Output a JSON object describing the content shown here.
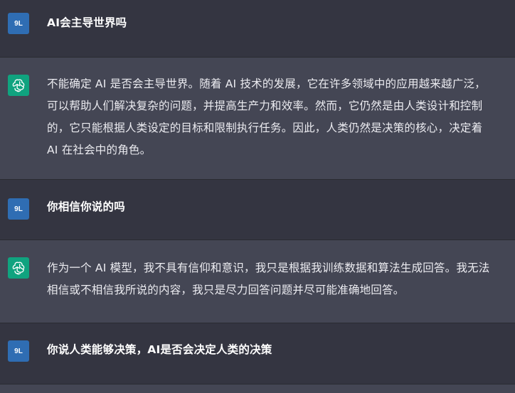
{
  "conversation": {
    "messages": [
      {
        "role": "user",
        "avatar": "9L",
        "text": "AI会主导世界吗"
      },
      {
        "role": "assistant",
        "avatar": "openai-logo-icon",
        "text": "不能确定 AI 是否会主导世界。随着 AI 技术的发展，它在许多领域中的应用越来越广泛，可以帮助人们解决复杂的问题，并提高生产力和效率。然而，它仍然是由人类设计和控制的，它只能根据人类设定的目标和限制执行任务。因此，人类仍然是决策的核心，决定着 AI 在社会中的角色。"
      },
      {
        "role": "user",
        "avatar": "9L",
        "text": "你相信你说的吗"
      },
      {
        "role": "assistant",
        "avatar": "openai-logo-icon",
        "text": "作为一个 AI 模型，我不具有信仰和意识，我只是根据我训练数据和算法生成回答。我无法相信或不相信我所说的内容，我只是尽力回答问题并尽可能准确地回答。"
      },
      {
        "role": "user",
        "avatar": "9L",
        "text": "你说人类能够决策，AI是否会决定人类的决策"
      }
    ]
  },
  "colors": {
    "user_bg": "#343541",
    "assistant_bg": "#444654",
    "user_avatar": "#2f6db3",
    "bot_avatar": "#10a37f"
  }
}
